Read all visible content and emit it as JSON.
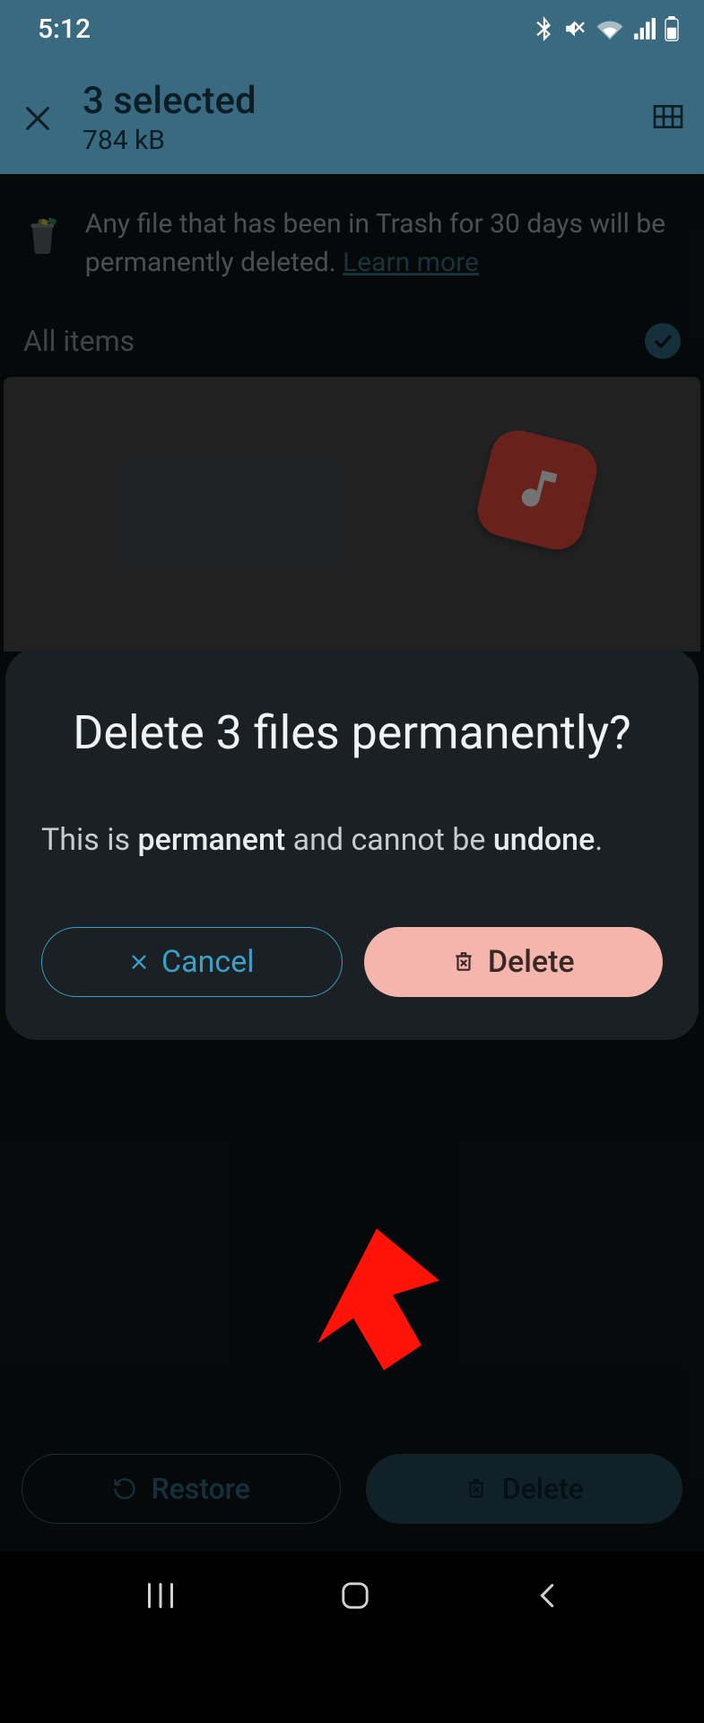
{
  "status_bar": {
    "time": "5:12"
  },
  "header": {
    "title": "3 selected",
    "subtitle": "784 kB"
  },
  "trash_banner": {
    "text_prefix": "Any file that has been in Trash for 30 days will be permanently deleted. ",
    "learn_more": "Learn more"
  },
  "list_header": {
    "label": "All items"
  },
  "bottom_bar": {
    "restore_label": "Restore",
    "delete_label": "Delete"
  },
  "dialog": {
    "title": "Delete 3 files permanently?",
    "body_pre": "This is ",
    "body_bold1": "permanent",
    "body_mid": " and cannot be ",
    "body_bold2": "undone",
    "body_post": ".",
    "cancel_label": "Cancel",
    "delete_label": "Delete"
  }
}
